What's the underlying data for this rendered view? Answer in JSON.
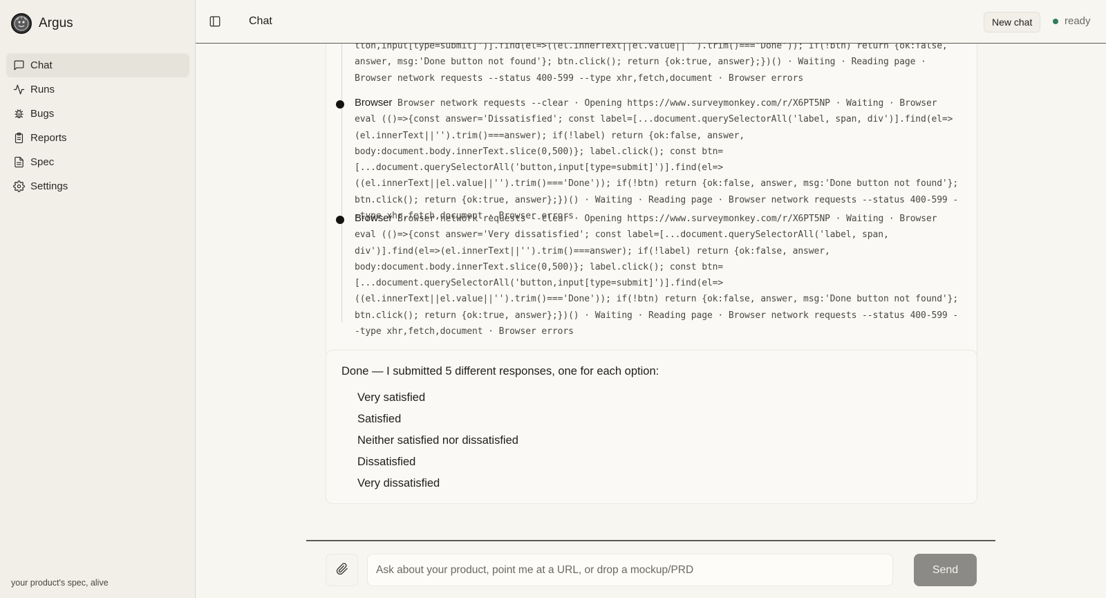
{
  "app": {
    "name": "Argus",
    "tagline": "your product's spec, alive"
  },
  "sidebar": {
    "items": [
      {
        "label": "Chat",
        "icon": "message-square-icon",
        "active": true
      },
      {
        "label": "Runs",
        "icon": "activity-icon"
      },
      {
        "label": "Bugs",
        "icon": "bug-icon"
      },
      {
        "label": "Reports",
        "icon": "clipboard-icon"
      },
      {
        "label": "Spec",
        "icon": "file-text-icon"
      },
      {
        "label": "Settings",
        "icon": "gear-icon"
      }
    ]
  },
  "header": {
    "title": "Chat",
    "new_chat_label": "New chat",
    "status": "ready",
    "status_color": "#2e7d5b"
  },
  "tool_log": {
    "top_fragment": "tton,input[type=submit]')].find(el=>((el.innerText||el.value||'').trim()==='Done')); if(!btn) return {ok:false, answer, msg:'Done button not found'}; btn.click(); return {ok:true, answer};})() · Waiting · Reading page · Browser network requests --status 400-599 --type xhr,fetch,document · Browser errors",
    "entries": [
      {
        "label": "Browser",
        "text": "Browser network requests --clear · Opening https://www.surveymonkey.com/r/X6PT5NP · Waiting · Browser eval (()=>{const answer='Dissatisfied'; const label=[...document.querySelectorAll('label, span, div')].find(el=>(el.innerText||'').trim()===answer); if(!label) return {ok:false, answer, body:document.body.innerText.slice(0,500)}; label.click(); const btn=[...document.querySelectorAll('button,input[type=submit]')].find(el=>((el.innerText||el.value||'').trim()==='Done')); if(!btn) return {ok:false, answer, msg:'Done button not found'}; btn.click(); return {ok:true, answer};})() · Waiting · Reading page · Browser network requests --status 400-599 --type xhr,fetch,document · Browser errors"
      },
      {
        "label": "Browser",
        "text": "Browser network requests --clear · Opening https://www.surveymonkey.com/r/X6PT5NP · Waiting · Browser eval (()=>{const answer='Very dissatisfied'; const label=[...document.querySelectorAll('label, span, div')].find(el=>(el.innerText||'').trim()===answer); if(!label) return {ok:false, answer, body:document.body.innerText.slice(0,500)}; label.click(); const btn=[...document.querySelectorAll('button,input[type=submit]')].find(el=>((el.innerText||el.value||'').trim()==='Done')); if(!btn) return {ok:false, answer, msg:'Done button not found'}; btn.click(); return {ok:true, answer};})() · Waiting · Reading page · Browser network requests --status 400-599 --type xhr,fetch,document · Browser errors"
      }
    ]
  },
  "answer": {
    "intro": "Done — I submitted 5 different responses, one for each option:",
    "options": [
      "Very satisfied",
      "Satisfied",
      "Neither satisfied nor dissatisfied",
      "Dissatisfied",
      "Very dissatisfied"
    ]
  },
  "composer": {
    "placeholder": "Ask about your product, point me at a URL, or drop a mockup/PRD",
    "send_label": "Send",
    "attach_icon": "paperclip-icon"
  }
}
